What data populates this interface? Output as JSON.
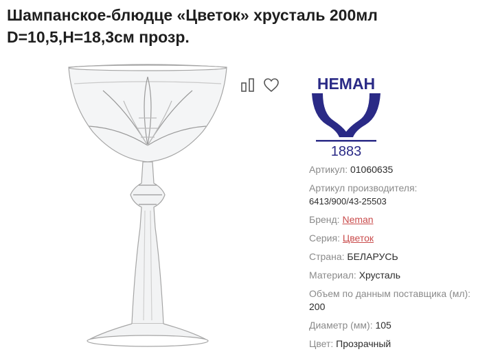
{
  "product": {
    "title_line1": "Шампанское-блюдце «Цветок» хрусталь 200мл",
    "title_line2": "D=10,5,H=18,3см прозр."
  },
  "actions": {
    "compare_icon": "compare-icon",
    "favorite_icon": "heart-icon"
  },
  "brand_logo": {
    "text": "НЕМАН",
    "year": "1883",
    "color": "#2a2a86"
  },
  "specs": {
    "article": {
      "key": "Артикул:",
      "value": "01060635"
    },
    "maker_article": {
      "key": "Артикул производителя:",
      "value": "6413/900/43-25503"
    },
    "brand": {
      "key": "Бренд:",
      "value": "Neman"
    },
    "series": {
      "key": "Серия:",
      "value": "Цветок"
    },
    "country": {
      "key": "Страна:",
      "value": "БЕЛАРУСЬ"
    },
    "material": {
      "key": "Материал:",
      "value": "Хрусталь"
    },
    "volume": {
      "key": "Объем по данным поставщика (мл):",
      "value": "200"
    },
    "diameter": {
      "key": "Диаметр (мм):",
      "value": "105"
    },
    "color": {
      "key": "Цвет:",
      "value": "Прозрачный"
    }
  },
  "colors": {
    "link": "#c94b4b",
    "label": "#8a8a8a"
  }
}
